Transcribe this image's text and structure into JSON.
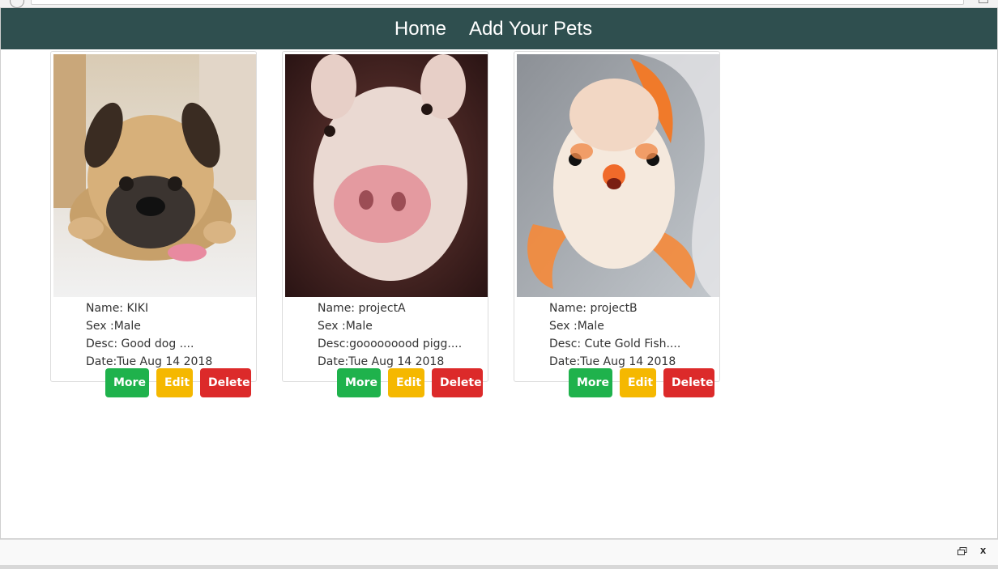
{
  "nav": {
    "home": "Home",
    "add_pets": "Add Your Pets"
  },
  "pets": [
    {
      "image_icon": "pug-dog-photo",
      "name": "Name: KIKI",
      "sex": "Sex :Male",
      "desc": "Desc: Good dog ....",
      "date": "Date:Tue Aug 14 2018",
      "more": "More",
      "edit": "Edit",
      "delete": "Delete"
    },
    {
      "image_icon": "pig-photo",
      "name": "Name: projectA",
      "sex": "Sex :Male",
      "desc": "Desc:gooooooood pigg....",
      "date": "Date:Tue Aug 14 2018",
      "more": "More",
      "edit": "Edit",
      "delete": "Delete"
    },
    {
      "image_icon": "goldfish-photo",
      "name": "Name: projectB",
      "sex": "Sex :Male",
      "desc": "Desc: Cute Gold Fish....",
      "date": "Date:Tue Aug 14 2018",
      "more": "More",
      "edit": "Edit",
      "delete": "Delete"
    }
  ],
  "colors": {
    "navbar": "#2f4f4f",
    "more": "#1fb24c",
    "edit": "#f5b800",
    "delete": "#dc2a2a"
  },
  "bottom_bar": {
    "close": "x"
  }
}
